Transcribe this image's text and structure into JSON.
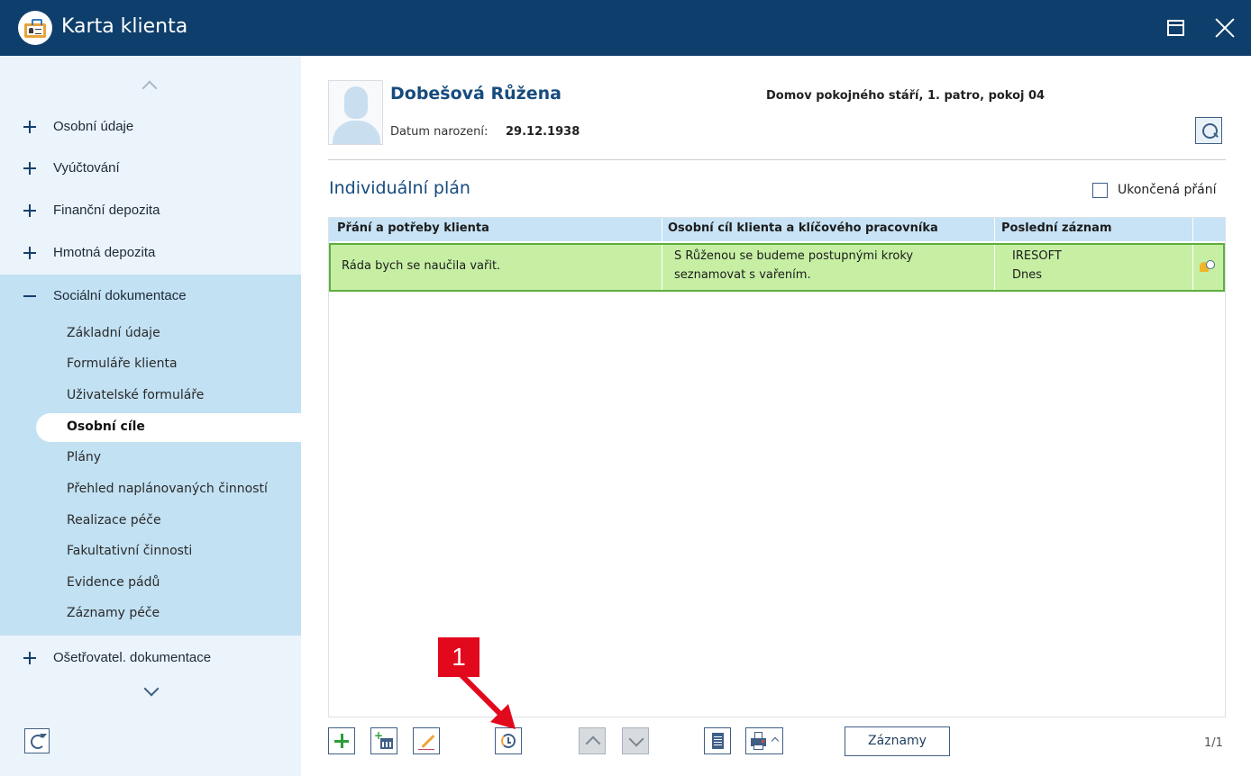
{
  "window": {
    "title": "Karta klienta",
    "maximize_icon": "maximize-icon",
    "close_icon": "close-icon"
  },
  "sidebar": {
    "collapsed_items": [
      {
        "label": "Osobní údaje"
      },
      {
        "label": "Vyúčtování"
      },
      {
        "label": "Finanční depozita"
      },
      {
        "label": "Hmotná depozita"
      }
    ],
    "expanded_item": {
      "label": "Sociální dokumentace"
    },
    "sub_items": [
      {
        "label": "Základní údaje"
      },
      {
        "label": "Formuláře klienta"
      },
      {
        "label": "Uživatelské formuláře"
      },
      {
        "label": "Osobní cíle",
        "active": true
      },
      {
        "label": "Plány"
      },
      {
        "label": "Přehled naplánovaných činností"
      },
      {
        "label": "Realizace péče"
      },
      {
        "label": "Fakultativní činnosti"
      },
      {
        "label": "Evidence pádů"
      },
      {
        "label": "Záznamy péče"
      }
    ],
    "after_items": [
      {
        "label": "Ošetřovatel. dokumentace"
      }
    ]
  },
  "client": {
    "name": "Dobešová Růžena",
    "birth_label": "Datum narození:",
    "birth_date": "29.12.1938",
    "location": "Domov pokojného stáří, 1. patro, pokoj 04"
  },
  "plan": {
    "title": "Individuální plán",
    "ended_wishes_label": "Ukončená přání",
    "ended_wishes_checked": false,
    "columns": [
      "Přání a potřeby klienta",
      "Osobní cíl klienta a klíčového pracovníka",
      "Poslední záznam"
    ],
    "rows": [
      {
        "wish": "Ráda bych se naučila vařit.",
        "goal_line1": "S Růženou se budeme postupnými kroky",
        "goal_line2": "seznamovat s vařením.",
        "last_record_by": "IRESOFT",
        "last_record_when": "Dnes"
      }
    ]
  },
  "toolbar": {
    "records_label": "Záznamy",
    "pager": "1/1"
  },
  "annotation": {
    "badge": "1",
    "color": "#e3091c"
  },
  "colors": {
    "titlebar": "#0e3e6b",
    "sidebar_bg": "#ebf3fb",
    "sidebar_section": "#c2e1f3",
    "header_row": "#c8e3f5",
    "selected_row": "#c6efa4",
    "selected_row_border": "#5fae3d",
    "accent_text": "#174b7e"
  }
}
